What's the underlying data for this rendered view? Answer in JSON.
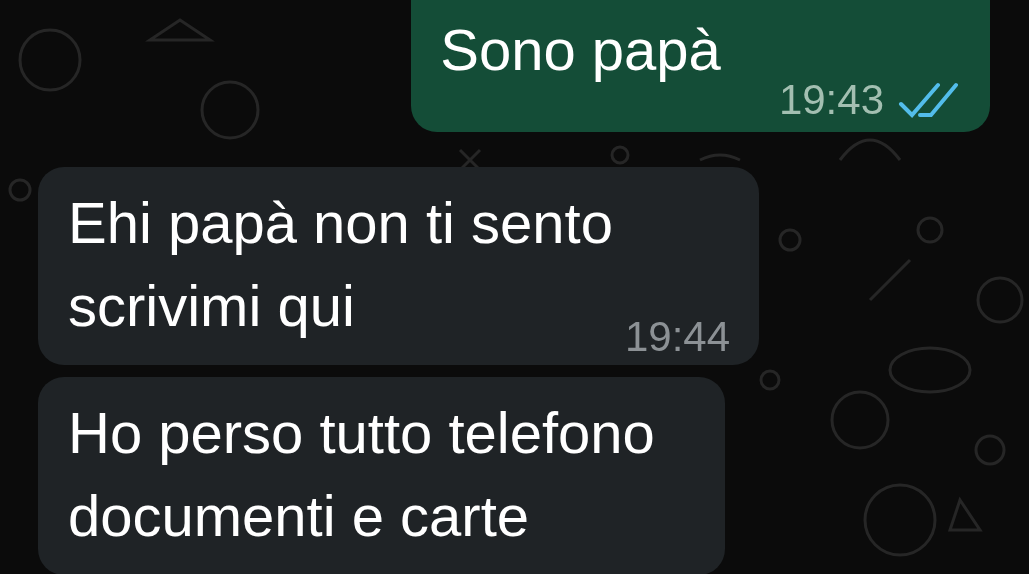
{
  "messages": [
    {
      "kind": "outgoing",
      "text": "Sono papà",
      "time": "19:43",
      "read": true
    },
    {
      "kind": "incoming",
      "text": "Ehi papà non ti sento\nscrivimi qui",
      "time": "19:44"
    },
    {
      "kind": "incoming",
      "text": "Ho perso tutto telefono\ndocumenti e carte"
    }
  ]
}
